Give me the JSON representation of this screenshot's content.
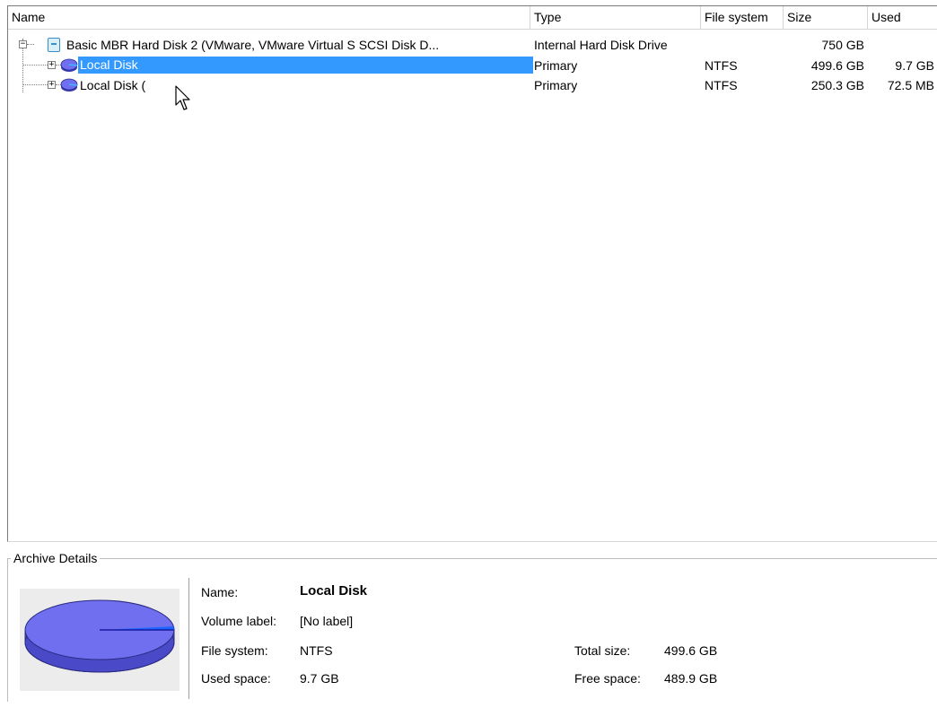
{
  "columns": {
    "name": "Name",
    "type": "Type",
    "file_system": "File system",
    "size": "Size",
    "used": "Used"
  },
  "rows": [
    {
      "name": "Basic MBR Hard Disk 2 (VMware, VMware Virtual S SCSI Disk D...",
      "type": "Internal Hard Disk Drive",
      "file_system": "",
      "size": "750 GB",
      "used": ""
    },
    {
      "name": "Local Disk",
      "type": "Primary",
      "file_system": "NTFS",
      "size": "499.6 GB",
      "used": "9.7 GB"
    },
    {
      "name": "Local Disk (",
      "type": "Primary",
      "file_system": "NTFS",
      "size": "250.3 GB",
      "used": "72.5 MB"
    }
  ],
  "details": {
    "group_title": "Archive Details",
    "name_label": "Name:",
    "name_value": "Local Disk",
    "volume_label_label": "Volume label:",
    "volume_label_value": "[No label]",
    "file_system_label": "File system:",
    "file_system_value": "NTFS",
    "used_space_label": "Used space:",
    "used_space_value": "9.7 GB",
    "total_size_label": "Total size:",
    "total_size_value": "499.6 GB",
    "free_space_label": "Free space:",
    "free_space_value": "489.9 GB",
    "used_fraction": 0.019
  },
  "colors": {
    "selection": "#3399ff",
    "pie": "#6f6ff0",
    "pie_side": "#4a4ac8"
  },
  "icons": {
    "disk": "hard-disk-icon",
    "volume": "volume-icon",
    "expand": "expand-plus-icon",
    "collapse": "collapse-minus-icon",
    "cursor": "mouse-cursor-icon"
  }
}
